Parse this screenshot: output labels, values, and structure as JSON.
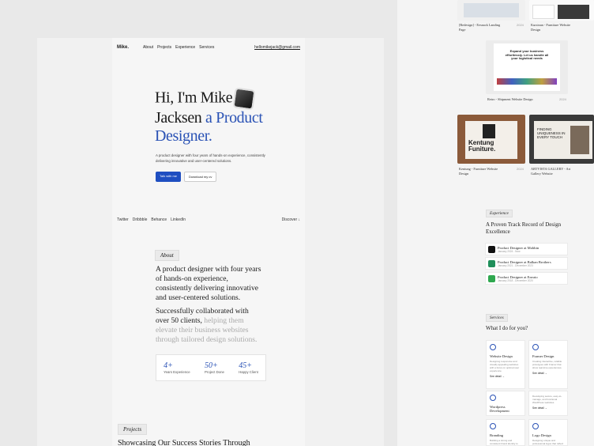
{
  "nav": {
    "logo": "Mike.",
    "links": [
      "About",
      "Projects",
      "Experience",
      "Services"
    ],
    "email": "hellomikejack@gmail.com"
  },
  "hero": {
    "line1": "Hi, I'm Mike",
    "line2a": "Jacksen",
    "line2b": "a Product",
    "line3": "Designer.",
    "intro": "A product designer with four years of hands-on experience, consistently delivering innovative and user-centered solutions.",
    "primary_btn": "Talk with me",
    "secondary_btn": "Download my cv"
  },
  "socials": [
    "Twitter",
    "Dribbble",
    "Behance",
    "LinkedIn"
  ],
  "discover": "Discover ↓",
  "about": {
    "tag": "About",
    "text": "A product designer with four years of hands-on experience, consistently delivering innovative and user-centered solutions.",
    "text2_dark": "Successfully collaborated with over 50 clients,",
    "text2_muted": "helping them elevate their business websites through tailored design solutions.",
    "stats": [
      {
        "value": "4+",
        "label": "Years Experience"
      },
      {
        "value": "50+",
        "label": "Project Done"
      },
      {
        "value": "45+",
        "label": "Happy Client"
      }
    ]
  },
  "projects": {
    "tag": "Projects",
    "heading": "Showcasing Our Success Stories Through"
  },
  "portfolio": [
    {
      "caption": "[Redesign] - Eesnack Landing Page",
      "year": "2024"
    },
    {
      "caption": "Kursinan - Furniture Website Design",
      "year": "2024"
    },
    {
      "caption": "Retro - Shipment Website Design",
      "year": "2024",
      "thumb_text": "Expand your business effortlessly. Let us handle all your logistical needs"
    },
    {
      "caption": "Kentung - Furniture Website Design",
      "year": "2024",
      "thumb_text": "Kentung Funiture."
    },
    {
      "caption": "ARTVISTA GALLERY - Art Gallery Website",
      "year": "2024",
      "thumb_text": "FINDING UNIQUENESS IN EVERY TOUCH"
    }
  ],
  "experience": {
    "tag": "Experience",
    "title": "A Proven Track Record of Design Excellence",
    "items": [
      {
        "title": "Product Designer at Mobbin",
        "date": "January 2024 - Now",
        "color": "#111111"
      },
      {
        "title": "Product Designer at Balkan Brothers",
        "date": "January 2021 - December 2023",
        "color": "#1f8f5a"
      },
      {
        "title": "Product Designer at Envato",
        "date": "January 2018 - December 2020",
        "color": "#2fa84f"
      }
    ]
  },
  "services": {
    "tag": "Services",
    "title": "What I do for you?",
    "items": [
      {
        "title": "Website Design",
        "desc": "Designing responsive and visually appealing websites with a focus on optimal user experience.",
        "link": "See detail →"
      },
      {
        "title": "Framer Design",
        "desc": "Creating interactive, reliable prototypes with Framer that show real-time experiences.",
        "link": "See detail →"
      },
      {
        "title": "Wordpress Development",
        "desc": "Developing secure, easy-to-manage, and functional WordPress websites.",
        "link": "See detail →"
      },
      {
        "title": "Branding",
        "desc": "Building a strong and consistent brand identity to stand out.",
        "link": ""
      },
      {
        "title": "Logo Design",
        "desc": "Designing unique and professional logos that reflect your brand.",
        "link": ""
      }
    ]
  }
}
